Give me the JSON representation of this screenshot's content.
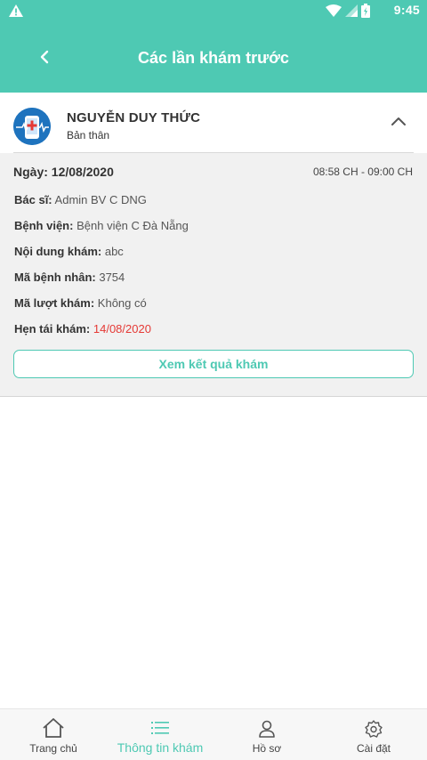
{
  "status_bar": {
    "time": "9:45",
    "icons": [
      "warning-icon",
      "wifi-icon",
      "signal-icon",
      "battery-icon"
    ]
  },
  "app_bar": {
    "title": "Các lần khám trước",
    "back_icon": "chevron-left-icon"
  },
  "patient": {
    "name": "NGUYỄN DUY THỨC",
    "relation": "Bản thân",
    "avatar_icon": "medical-avatar-icon",
    "toggle_icon": "chevron-up-icon"
  },
  "visit": {
    "date_label": "Ngày:",
    "date_value": "12/08/2020",
    "time_range": "08:58 CH - 09:00 CH",
    "fields": [
      {
        "label": "Bác sĩ:",
        "value": "Admin BV C DNG"
      },
      {
        "label": "Bệnh viện:",
        "value": "Bệnh viện C Đà Nẵng"
      },
      {
        "label": "Nội dung khám:",
        "value": "abc"
      },
      {
        "label": "Mã bệnh nhân:",
        "value": "3754"
      },
      {
        "label": "Mã lượt khám:",
        "value": "Không có"
      },
      {
        "label": "Hẹn tái khám:",
        "value": "14/08/2020"
      }
    ],
    "result_button": "Xem kết quả khám"
  },
  "bottom_nav": [
    {
      "label": "Trang chủ",
      "icon": "home-icon",
      "active": false
    },
    {
      "label": "Thông tin khám",
      "icon": "list-icon",
      "active": true
    },
    {
      "label": "Hồ sơ",
      "icon": "user-icon",
      "active": false
    },
    {
      "label": "Cài đặt",
      "icon": "gear-icon",
      "active": false
    }
  ],
  "colors": {
    "primary": "#4ec9b3",
    "accent_red": "#e53935",
    "detail_bg": "#f1f1f1"
  }
}
